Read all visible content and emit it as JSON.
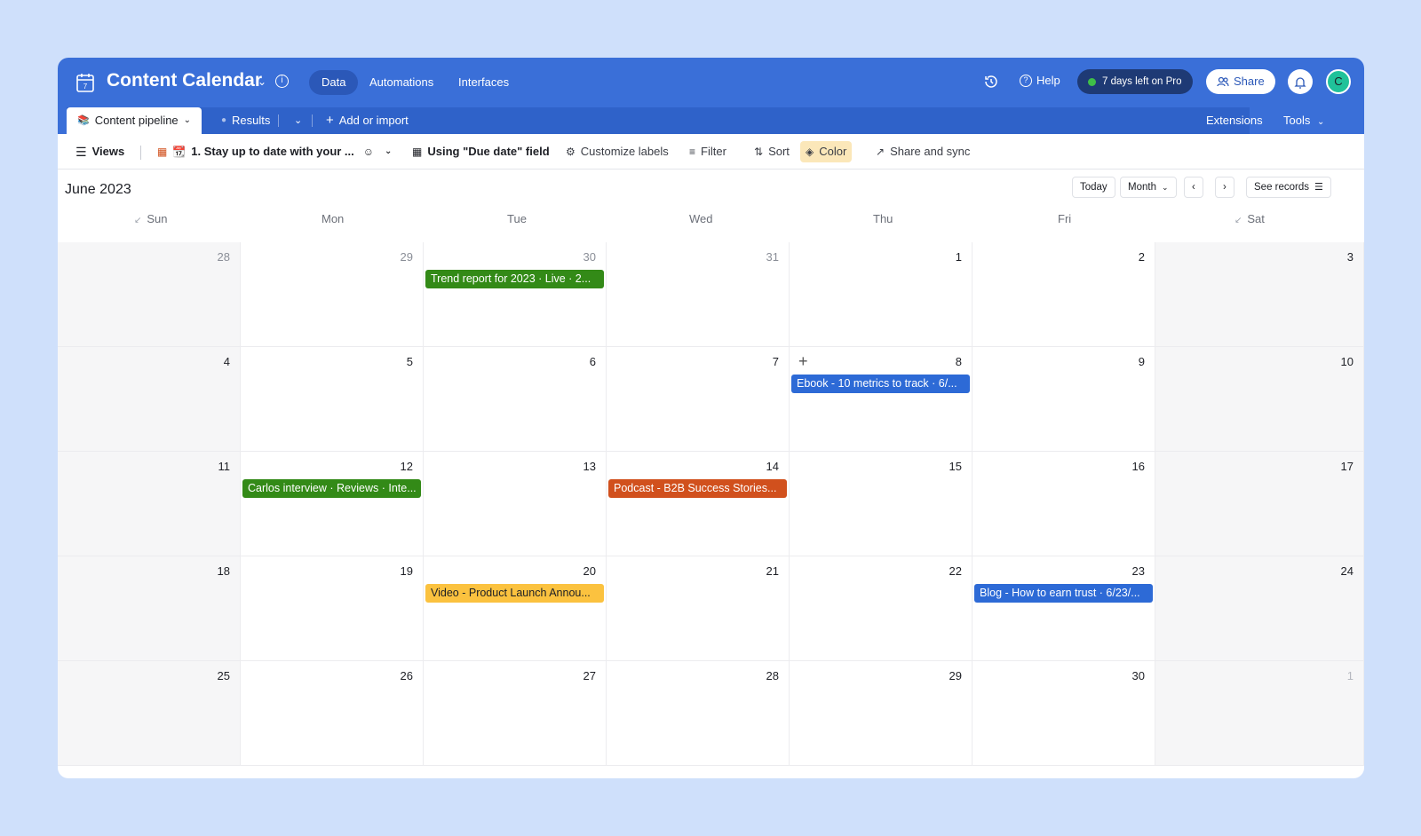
{
  "topbar": {
    "title": "Content Calendar",
    "tabs": [
      "Data",
      "Automations",
      "Interfaces"
    ],
    "help": "Help",
    "trial": "7 days left on Pro",
    "share": "Share",
    "avatar_initial": "C"
  },
  "tables": {
    "active": "Content pipeline",
    "second": "Results",
    "add": "Add or import",
    "extensions": "Extensions",
    "tools": "Tools"
  },
  "toolbar": {
    "views": "Views",
    "view_name": "1. Stay up to date with your ...",
    "date_field": "Using \"Due date\" field",
    "customize": "Customize labels",
    "filter": "Filter",
    "sort": "Sort",
    "color": "Color",
    "share_sync": "Share and sync"
  },
  "calendar": {
    "month": "June 2023",
    "today": "Today",
    "mode": "Month",
    "see_records": "See records",
    "days_of_week": [
      "Sun",
      "Mon",
      "Tue",
      "Wed",
      "Thu",
      "Fri",
      "Sat"
    ],
    "weeks": [
      [
        "28",
        "29",
        "30",
        "31",
        "1",
        "2",
        "3"
      ],
      [
        "4",
        "5",
        "6",
        "7",
        "8",
        "9",
        "10"
      ],
      [
        "11",
        "12",
        "13",
        "14",
        "15",
        "16",
        "17"
      ],
      [
        "18",
        "19",
        "20",
        "21",
        "22",
        "23",
        "24"
      ],
      [
        "25",
        "26",
        "27",
        "28",
        "29",
        "30",
        "1"
      ]
    ],
    "events": [
      {
        "week": 0,
        "day": 2,
        "color": "#338a17",
        "label": "Trend report for 2023 · Live · 2..."
      },
      {
        "week": 1,
        "day": 4,
        "color": "#2d6ad6",
        "label": "Ebook - 10 metrics to track · 6/..."
      },
      {
        "week": 2,
        "day": 1,
        "color": "#338a17",
        "label": "Carlos interview · Reviews · Inte..."
      },
      {
        "week": 2,
        "day": 3,
        "color": "#d1501d",
        "label": "Podcast - B2B Success Stories..."
      },
      {
        "week": 3,
        "day": 2,
        "color": "#fbc23f",
        "label": "Video - Product Launch Annou..."
      },
      {
        "week": 3,
        "day": 5,
        "color": "#2d6ad6",
        "label": "Blog - How to earn trust · 6/23/..."
      }
    ]
  }
}
